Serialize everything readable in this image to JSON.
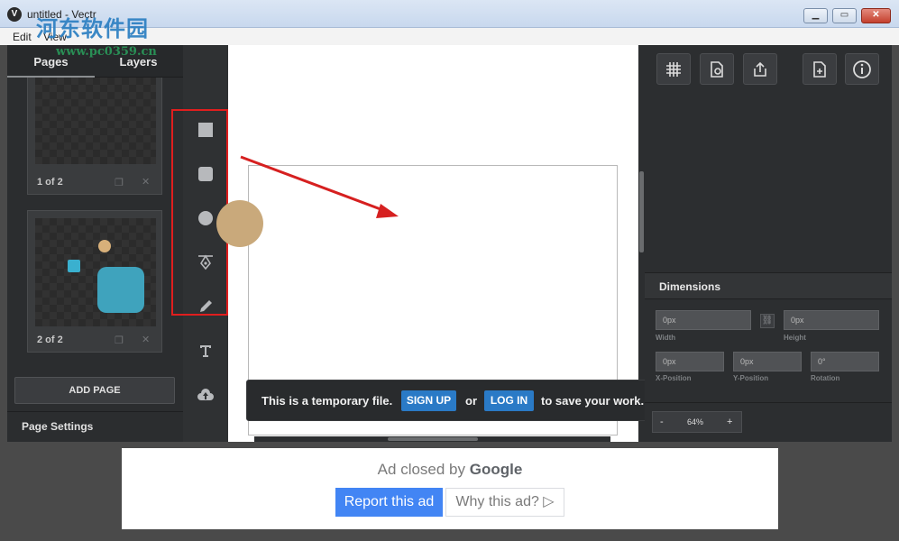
{
  "window": {
    "title": "untitled - Vectr",
    "watermark_text": "河东软件园",
    "watermark_url": "www.pc0359.cn",
    "min_glyph": "▁",
    "max_glyph": "▭",
    "close_glyph": "✕"
  },
  "menu": {
    "items": [
      "Edit",
      "View"
    ]
  },
  "left_panel": {
    "tabs": [
      "Pages",
      "Layers"
    ],
    "pages": [
      {
        "label": "1 of 2"
      },
      {
        "label": "2 of 2"
      }
    ],
    "add_page_label": "ADD PAGE",
    "page_settings_label": "Page Settings"
  },
  "tools": [
    "rectangle-icon",
    "rounded-rectangle-icon",
    "ellipse-icon",
    "pen-icon",
    "pencil-icon",
    "text-icon",
    "upload-icon"
  ],
  "toast": {
    "text_before": "This is a temporary file.",
    "signup_label": "SIGN UP",
    "or_label": "or",
    "login_label": "LOG IN",
    "text_after": "to save your work."
  },
  "right_panel": {
    "toolbar": [
      "grid-icon",
      "page-settings-icon",
      "export-icon",
      "new-page-icon",
      "info-icon"
    ],
    "dimensions_title": "Dimensions",
    "width": {
      "value": "0px",
      "label": "Width"
    },
    "height": {
      "value": "0px",
      "label": "Height"
    },
    "x": {
      "value": "0px",
      "label": "X-Position"
    },
    "y": {
      "value": "0px",
      "label": "Y-Position"
    },
    "rotation": {
      "value": "0°",
      "label": "Rotation"
    },
    "zoom": {
      "minus": "-",
      "value": "64%",
      "plus": "+"
    }
  },
  "ad": {
    "closed_prefix": "Ad closed by",
    "closed_brand": "Google",
    "report_label": "Report this ad",
    "why_label": "Why this ad? ▷"
  },
  "colors": {
    "shape_circle": "#c9a97b",
    "shape_square": "#3fa3bd",
    "thumb_circle": "#d8b07a",
    "thumb_square": "#3ab0cf",
    "highlight": "#e01e1e",
    "accent_button": "#2a7ac6"
  }
}
